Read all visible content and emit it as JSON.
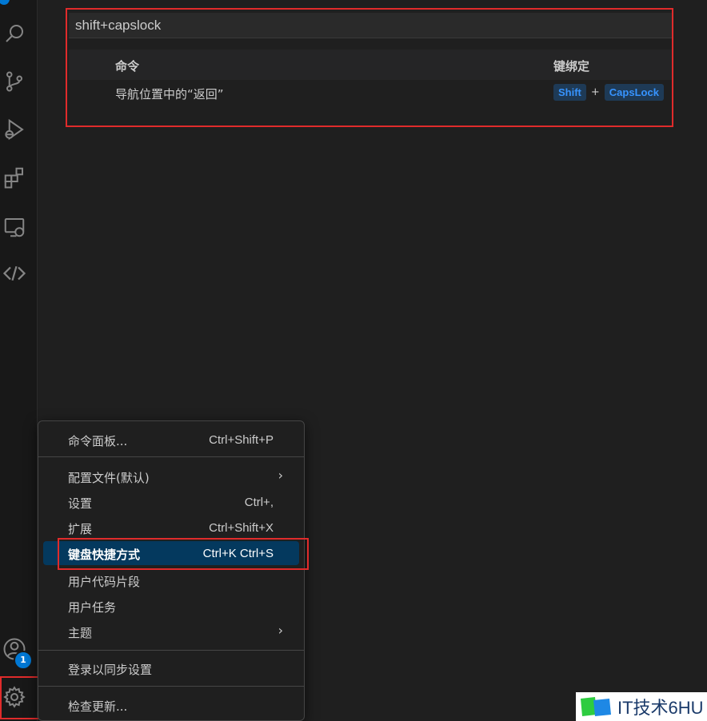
{
  "search": {
    "value": "shift+capslock"
  },
  "keybindings_table": {
    "headers": {
      "command": "命令",
      "keybinding": "键绑定"
    },
    "rows": [
      {
        "command": "导航位置中的“返回”",
        "keys": [
          "Shift",
          "CapsLock"
        ],
        "separator": "+"
      }
    ]
  },
  "activity_bar": {
    "icons": [
      "search-icon",
      "source-control-icon",
      "run-debug-icon",
      "extensions-icon",
      "remote-explorer-icon",
      "code-share-icon",
      "account-icon",
      "manage-gear-icon"
    ],
    "account_badge": "1"
  },
  "manage_menu": {
    "items": [
      {
        "label": "命令面板...",
        "shortcut": "Ctrl+Shift+P"
      },
      {
        "label": "配置文件(默认)",
        "submenu": "›"
      },
      {
        "label": "设置",
        "shortcut": "Ctrl+,"
      },
      {
        "label": "扩展",
        "shortcut": "Ctrl+Shift+X"
      },
      {
        "label": "键盘快捷方式",
        "shortcut": "Ctrl+K Ctrl+S",
        "active": true
      },
      {
        "label": "用户代码片段"
      },
      {
        "label": "用户任务"
      },
      {
        "label": "主题",
        "submenu": "›"
      },
      {
        "label": "登录以同步设置"
      },
      {
        "label": "检查更新..."
      }
    ]
  },
  "watermark": {
    "text": "IT技术6HU"
  },
  "colors": {
    "accent": "#0078d4",
    "highlight": "#e02b2b",
    "selection": "#04395e",
    "keycap_text": "#3794ff"
  }
}
